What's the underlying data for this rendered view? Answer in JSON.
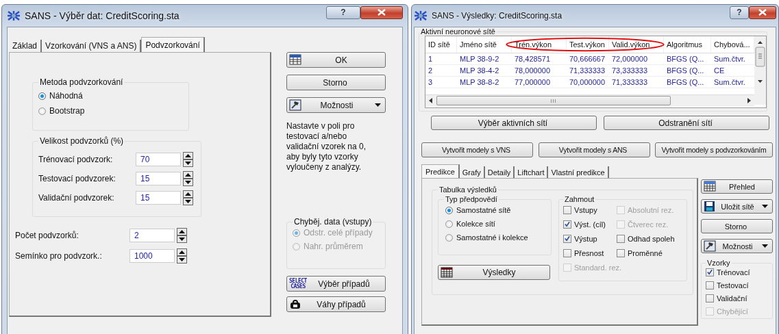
{
  "left_window": {
    "title": "SANS - Výběr dat: CreditScoring.sta",
    "help": "?",
    "tabs": [
      {
        "label": "Základ",
        "selected": false
      },
      {
        "label": "Vzorkování (VNS a ANS)",
        "selected": false
      },
      {
        "label": "Podvzorkování",
        "selected": true
      }
    ],
    "method_group": {
      "title": "Metoda podvzorkování",
      "options": [
        {
          "label": "Náhodná",
          "selected": true
        },
        {
          "label": "Bootstrap",
          "selected": false
        }
      ]
    },
    "size_group": {
      "title": "Velikost podvzorků (%)",
      "fields": [
        {
          "label": "Trénovací podvzork:",
          "value": "70"
        },
        {
          "label": "Testovací podvzorek:",
          "value": "15"
        },
        {
          "label": "Validační podvzorek:",
          "value": "15"
        }
      ]
    },
    "fields": [
      {
        "label": "Počet podvzorků:",
        "value": "2"
      },
      {
        "label": "Semínko pro podvzork.:",
        "value": "1000"
      }
    ],
    "buttons": [
      {
        "kind": "ok",
        "label": "OK"
      },
      {
        "kind": "cancel",
        "label": "Storno"
      },
      {
        "kind": "options",
        "label": "Možnosti",
        "dropdown": true
      }
    ],
    "hint": "Nastavte v poli pro testovací a/nebo validační vzorek na 0, aby byly tyto vzorky vyloučeny z analýzy.",
    "missing_group": {
      "title": "Chyběj. data (vstupy)",
      "disabled": true,
      "options": [
        {
          "label": "Odstr. celé případy",
          "selected": true
        },
        {
          "label": "Nahr. průměrem",
          "selected": false
        }
      ]
    },
    "case_buttons": [
      {
        "kind": "select",
        "label": "Výběr případů",
        "icon_text": [
          "SELECT",
          "CASES"
        ]
      },
      {
        "kind": "weights",
        "label": "Váhy případů"
      }
    ]
  },
  "right_window": {
    "title": "SANS - Výsledky: CreditScoring.sta",
    "help": "?",
    "group_title": "Aktivní neuronové sítě",
    "table": {
      "columns": [
        {
          "label": "ID sítě",
          "circled": false
        },
        {
          "label": "Jméno sítě",
          "circled": false
        },
        {
          "label": "Trén.výkon",
          "circled": true
        },
        {
          "label": "Test.výkon",
          "circled": true
        },
        {
          "label": "Valid.výkon",
          "circled": true
        },
        {
          "label": "Algoritmus",
          "circled": false
        },
        {
          "label": "Chybová...",
          "circled": false
        }
      ],
      "rows": [
        [
          "1",
          "MLP 38-9-2",
          "78,428571",
          "70,666667",
          "72,000000",
          "BFGS (Q...",
          "Sum.čtvr."
        ],
        [
          "2",
          "MLP 38-4-2",
          "78,000000",
          "71,333333",
          "73,333333",
          "BFGS (Q...",
          "CE"
        ],
        [
          "3",
          "MLP 38-8-2",
          "77,000000",
          "70,000000",
          "71,333333",
          "BFGS (Q...",
          "Sum.čtvr."
        ]
      ],
      "scroll_grip": "III"
    },
    "table_buttons": [
      {
        "label": "Výběr aktivních sítí"
      },
      {
        "label": "Odstranění sítí"
      }
    ],
    "create_buttons": [
      {
        "label": "Vytvořit modely s VNS"
      },
      {
        "label": "Vytvořit modely s ANS"
      },
      {
        "label": "Vytvořit modely s podvzorkováním"
      }
    ],
    "tabs": [
      {
        "label": "Predikce",
        "selected": true
      },
      {
        "label": "Grafy",
        "selected": false
      },
      {
        "label": "Detaily",
        "selected": false
      },
      {
        "label": "Liftchart",
        "selected": false
      },
      {
        "label": "Vlastní predikce",
        "selected": false
      }
    ],
    "results_group": {
      "title": "Tabulka výsledků",
      "type_group": {
        "title": "Typ předpovědí",
        "options": [
          {
            "label": "Samostatné sítě",
            "selected": true
          },
          {
            "label": "Kolekce sítí",
            "selected": false
          },
          {
            "label": "Samostatné i kolekce",
            "selected": false
          }
        ]
      },
      "results_button": {
        "kind": "results",
        "label": "Výsledky"
      },
      "include_group": {
        "title": "Zahmout",
        "items": [
          {
            "label": "Vstupy",
            "checked": false,
            "disabled": false
          },
          {
            "label": "Absolutní rez.",
            "checked": false,
            "disabled": true
          },
          {
            "label": "Výst. (cíl)",
            "checked": true,
            "disabled": false
          },
          {
            "label": "Čtverec rez.",
            "checked": false,
            "disabled": true
          },
          {
            "label": "Výstup",
            "checked": true,
            "disabled": false
          },
          {
            "label": "Odhad spoleh",
            "checked": false,
            "disabled": false
          },
          {
            "label": "Přesnost",
            "checked": false,
            "disabled": false
          },
          {
            "label": "Proměnné",
            "checked": false,
            "disabled": false
          },
          {
            "label": "Standard. rez.",
            "checked": false,
            "disabled": true
          }
        ]
      }
    },
    "side_buttons": [
      {
        "kind": "summary",
        "label": "Přehled"
      },
      {
        "kind": "save",
        "label": "Uložit sítě",
        "dropdown": true
      },
      {
        "kind": "cancel",
        "label": "Storno"
      },
      {
        "kind": "options",
        "label": "Možnosti",
        "dropdown": true
      }
    ],
    "samples_group": {
      "title": "Vzorky",
      "items": [
        {
          "label": "Trénovací",
          "checked": true,
          "disabled": false
        },
        {
          "label": "Testovací",
          "checked": false,
          "disabled": false
        },
        {
          "label": "Validační",
          "checked": false,
          "disabled": false
        },
        {
          "label": "Chybějící",
          "checked": false,
          "disabled": true
        }
      ]
    }
  }
}
